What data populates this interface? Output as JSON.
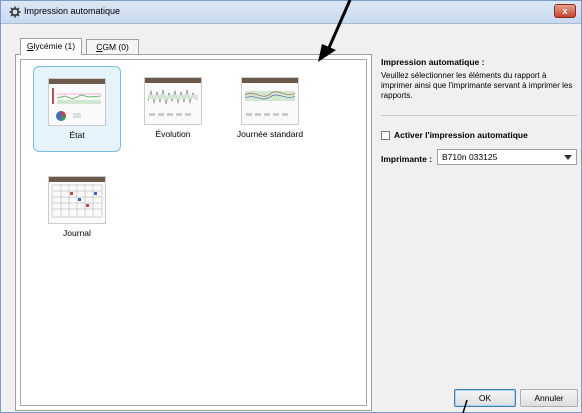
{
  "window": {
    "title": "Impression automatique",
    "close_label": "x"
  },
  "tabs": [
    {
      "label_prefix": "",
      "mnemonic": "G",
      "label_rest": "lycémie (1)",
      "active": true
    },
    {
      "label_prefix": "",
      "mnemonic": "C",
      "label_rest": "GM (0)",
      "active": false
    }
  ],
  "reports": [
    {
      "label": "État",
      "selected": true
    },
    {
      "label": "Évolution",
      "selected": false
    },
    {
      "label": "Journée standard",
      "selected": false
    },
    {
      "label": "Journal",
      "selected": false
    }
  ],
  "side": {
    "heading": "Impression automatique :",
    "description": "Veuillez sélectionner les éléments du rapport à imprimer ainsi que l'imprimante servant à imprimer les rapports.",
    "enable_label": "Activer l'impression automatique",
    "printer_label": "Imprimante :",
    "printer_value": "B710n 033125"
  },
  "buttons": {
    "ok": "OK",
    "cancel": "Annuler"
  },
  "colors": {
    "accent": "#7bbde4",
    "title_bg": "#c9d9ee",
    "close": "#c7432b"
  }
}
